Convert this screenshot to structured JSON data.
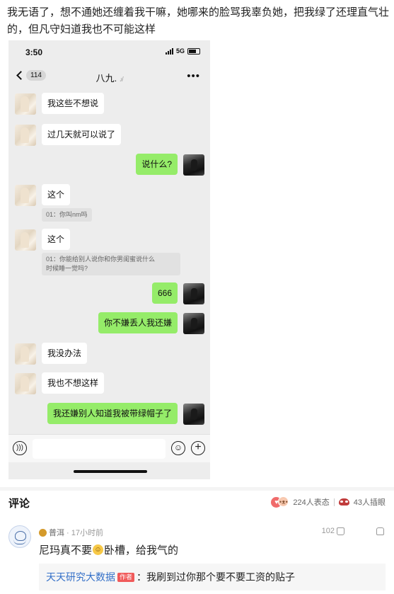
{
  "post": {
    "text": "我无语了，想不通她还缠着我干嘛，她哪来的脸骂我辜负她，把我绿了还理直气壮的，但凡守妇道我也不可能这样"
  },
  "screenshot": {
    "status": {
      "time": "3:50",
      "network": "5G"
    },
    "nav": {
      "unread_count": "114",
      "chat_title": "八九.",
      "more_icon": "more-dots-icon"
    },
    "messages": [
      {
        "side": "in",
        "text": "我这些不想说"
      },
      {
        "side": "in",
        "text": "过几天就可以说了"
      },
      {
        "side": "out",
        "text": "说什么?"
      },
      {
        "side": "in",
        "text": "这个",
        "quote": "01：你叫nm吗"
      },
      {
        "side": "in",
        "text": "这个",
        "quote": "01：你能给别人说你和你男闺蜜说什么时候睡一觉吗?"
      },
      {
        "side": "out",
        "text": "666"
      },
      {
        "side": "out",
        "text": "你不嫌丢人我还嫌"
      },
      {
        "side": "in",
        "text": "我没办法"
      },
      {
        "side": "in",
        "text": "我也不想这样"
      },
      {
        "side": "out",
        "text": "我还嫌别人知道我被带绿帽子了"
      }
    ],
    "quote_lines": {
      "q5_line1": "01：你能给别人说你和你男闺蜜说什么",
      "q5_line2": "时候睡一觉吗?"
    }
  },
  "comments": {
    "header": "评论",
    "reactions_count": "224人表态",
    "interjections_count": "43人插眼",
    "items": [
      {
        "user": "普洱",
        "time": "· 17小时前",
        "likes": "102",
        "text_before": "尼玛真不要",
        "text_after": "卧槽，给我气的",
        "reply": {
          "user": "天天研究大数据",
          "tag": "作者",
          "text": "：我刷到过你那个要不要工资的贴子"
        }
      }
    ]
  },
  "colors": {
    "out_bubble": "#95ec69",
    "in_bubble": "#ffffff",
    "chat_bg": "#ededed",
    "link": "#3470c8"
  }
}
